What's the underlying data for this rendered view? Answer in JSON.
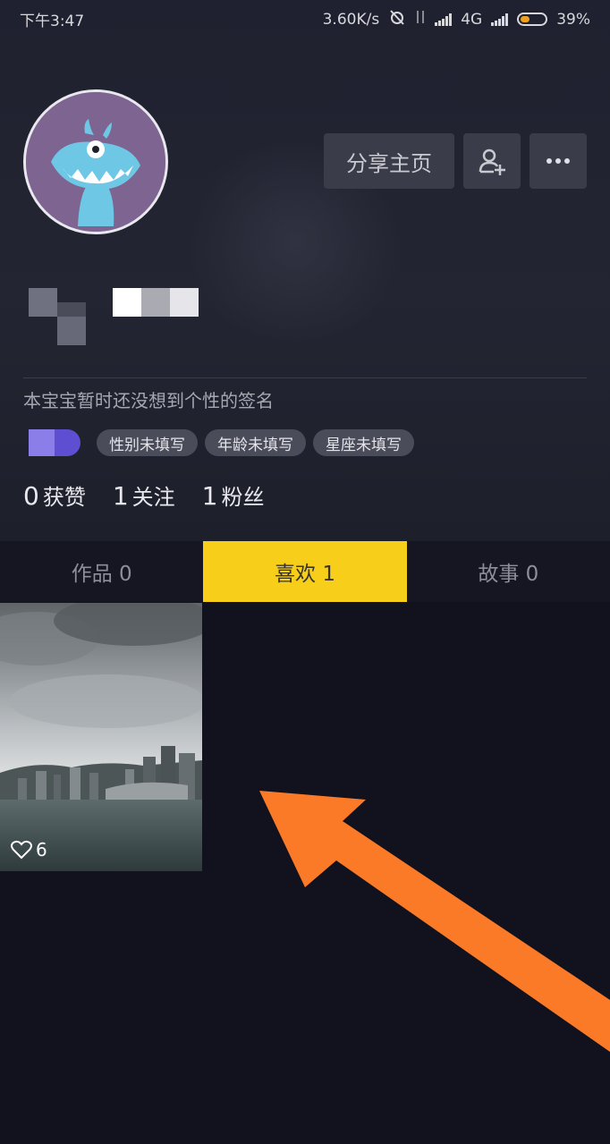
{
  "status_bar": {
    "time": "下午3:47",
    "network_speed": "3.60K/s",
    "network_type": "4G",
    "battery": "39%",
    "battery_level": 0.39
  },
  "profile": {
    "signature": "本宝宝暂时还没想到个性的签名",
    "tags": [
      "性别未填写",
      "年龄未填写",
      "星座未填写"
    ],
    "stats": [
      {
        "value": "0",
        "label": "获赞"
      },
      {
        "value": "1",
        "label": "关注"
      },
      {
        "value": "1",
        "label": "粉丝"
      }
    ]
  },
  "actions": {
    "share_label": "分享主页",
    "add_friend_icon": "add-user-icon",
    "more_icon": "more-icon"
  },
  "tabs": [
    {
      "label": "作品 0",
      "active": false
    },
    {
      "label": "喜欢 1",
      "active": true
    },
    {
      "label": "故事 0",
      "active": false
    }
  ],
  "liked_videos": [
    {
      "likes": "6"
    }
  ],
  "colors": {
    "accent": "#f7ce1a",
    "background": "#12121e",
    "annotation_arrow": "#fa7a28"
  }
}
